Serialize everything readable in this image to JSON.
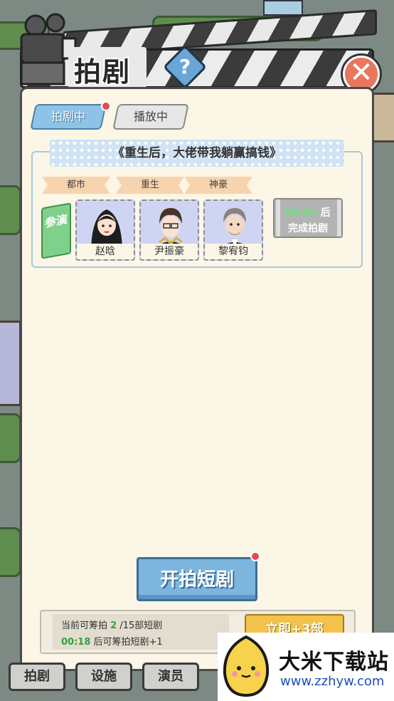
{
  "header": {
    "title": "拍剧",
    "help_label": "?",
    "close_label": "✕"
  },
  "tabs": [
    {
      "label": "拍剧中",
      "active": true,
      "has_dot": true
    },
    {
      "label": "播放中",
      "active": false,
      "has_dot": false
    }
  ],
  "drama": {
    "title": "《重生后，大佬带我躺赢搞钱》",
    "genres": [
      "都市",
      "重生",
      "神豪"
    ],
    "cast_label": "参演",
    "actors": [
      {
        "name": "赵晗"
      },
      {
        "name": "尹振豪"
      },
      {
        "name": "黎宥钧"
      }
    ],
    "timer": "00:02",
    "timer_suffix": "后",
    "timer_status": "完成拍剧"
  },
  "start_button": {
    "label": "开拍短剧",
    "has_dot": true
  },
  "info": {
    "prefix": "当前可筹拍",
    "available": "2",
    "suffix": "/15部短剧",
    "countdown": "00:18",
    "countdown_suffix": "后可筹拍短剧+1"
  },
  "ad_button": {
    "label": "立即+3部"
  },
  "bottom_nav": [
    "拍剧",
    "设施",
    "演员"
  ],
  "watermark": {
    "title": "大米下载站",
    "url": "www.zzhyw.com"
  },
  "colors": {
    "panel_bg": "#fbf6e6",
    "tab_active": "#8cc3e6",
    "accent_green": "#2fa43c",
    "start_button": "#7cb6df",
    "close_button": "#e8775f",
    "notification_dot": "#e54b4b"
  }
}
